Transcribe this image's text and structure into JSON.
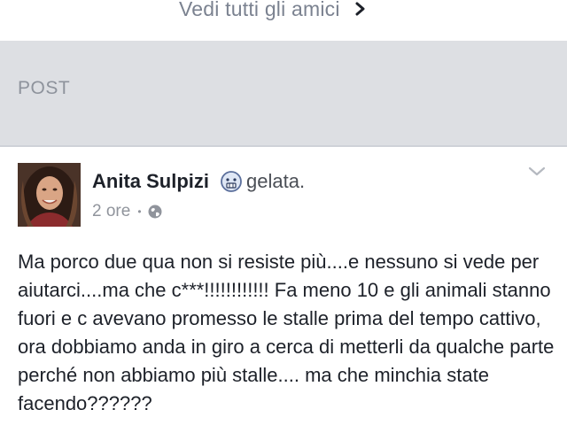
{
  "friends_section": {
    "see_all_label": "Vedi tutti gli amici",
    "chevron_icon": "chevron-right-icon"
  },
  "posts_section": {
    "title": "POST"
  },
  "post": {
    "author": "Anita Sulpizi",
    "feeling_icon": "cold-face-icon",
    "feeling": "gelata.",
    "time": "2 ore",
    "separator": "•",
    "privacy_icon": "globe-icon",
    "menu_icon": "chevron-down-icon",
    "text": "Ma porco due qua non si resiste più....e nessuno si vede per aiutarci....ma che c***!!!!!!!!!!!! Fa meno 10 e gli animali stanno fuori e c avevano promesso le stalle prima del tempo cattivo, ora dobbiamo anda in giro a cerca di metterli da qualche parte perché non abbiamo più stalle.... ma che minchia state facendo??????"
  },
  "colors": {
    "section_bg": "#dddfe3",
    "muted_text": "#90949c",
    "body_text": "#1d2129"
  }
}
